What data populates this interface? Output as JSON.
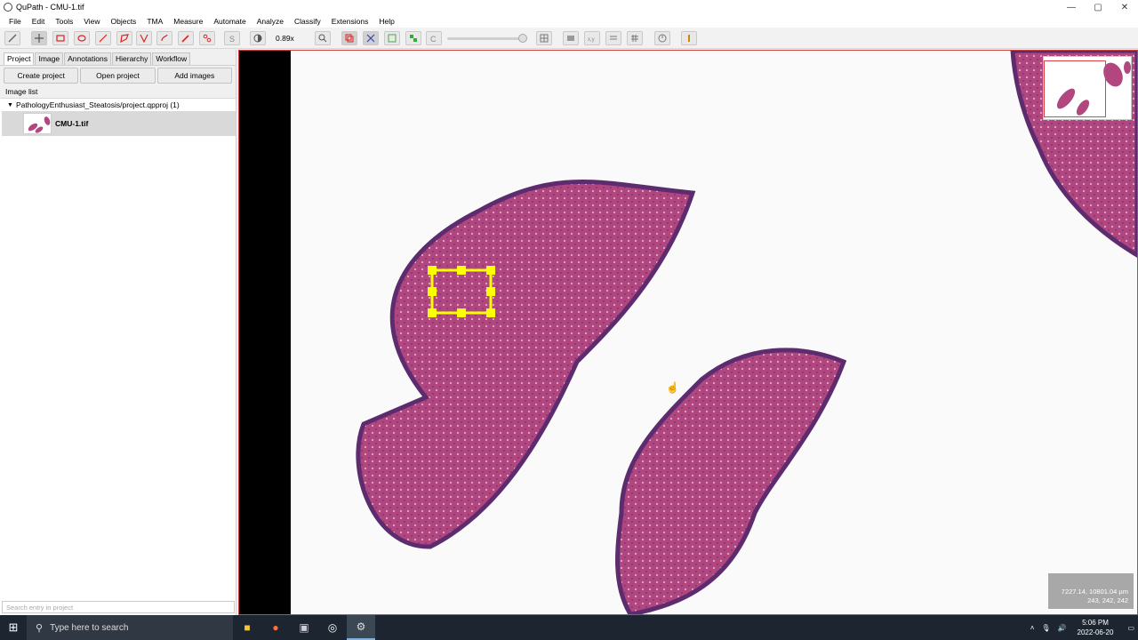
{
  "window": {
    "title": "QuPath - CMU-1.tif"
  },
  "window_controls": {
    "minimize": "—",
    "maximize": "▢",
    "close": "✕"
  },
  "menu": [
    "File",
    "Edit",
    "Tools",
    "View",
    "Objects",
    "TMA",
    "Measure",
    "Automate",
    "Analyze",
    "Classify",
    "Extensions",
    "Help"
  ],
  "toolbar": {
    "zoom": "0.89x"
  },
  "left_panel": {
    "tabs": [
      "Project",
      "Image",
      "Annotations",
      "Hierarchy",
      "Workflow"
    ],
    "buttons": [
      "Create project",
      "Open project",
      "Add images"
    ],
    "image_list_label": "Image list",
    "project_path": "PathologyEnthusiast_Steatosis/project.qpproj (1)",
    "image_item": "CMU-1.tif",
    "search_placeholder": "Search entry in project"
  },
  "viewer": {
    "coord_line1": "7227.14, 10801.04 µm",
    "coord_line2": "243, 242, 242"
  },
  "taskbar": {
    "search_placeholder": "Type here to search",
    "time": "5:06 PM",
    "date": "2022-06-20"
  },
  "colors": {
    "tissue": "#b2467e",
    "tissue_dark": "#6a3a7a",
    "selection": "#ffff00",
    "taskbar": "#1c2530"
  }
}
